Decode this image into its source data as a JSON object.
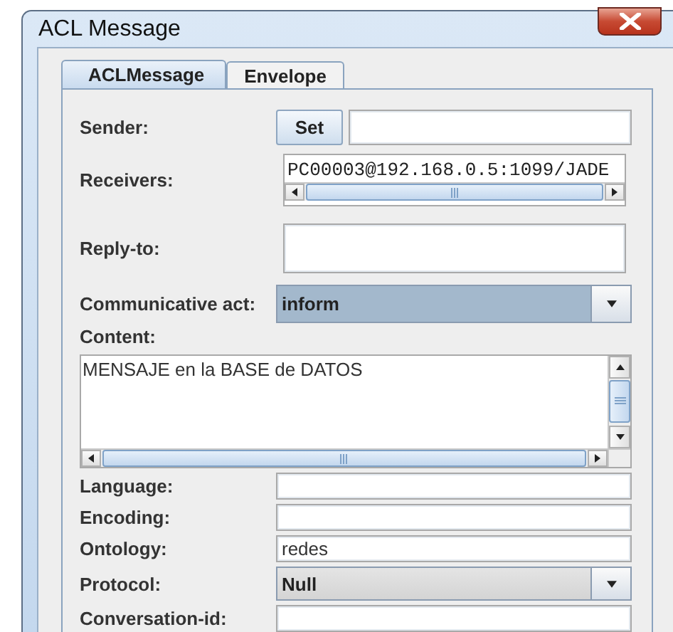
{
  "window": {
    "title": "ACL Message"
  },
  "tabs": [
    {
      "label": "ACLMessage",
      "selected": true
    },
    {
      "label": "Envelope",
      "selected": false
    }
  ],
  "fields": [
    {
      "kind": "button_field",
      "label": "Sender:",
      "button": "Set"
    },
    {
      "kind": "list",
      "label": "Receivers:",
      "items": [
        "PC00003@192.168.0.5:1099/JADE"
      ]
    },
    {
      "kind": "area",
      "label": "Reply-to:"
    },
    {
      "kind": "combo",
      "label": "Communicative act:",
      "value": "inform",
      "focused": true
    },
    {
      "kind": "textarea",
      "label": "Content:",
      "value": "MENSAJE en la BASE de DATOS"
    },
    {
      "kind": "text",
      "label": "Language:"
    },
    {
      "kind": "text",
      "label": "Encoding:"
    },
    {
      "kind": "text",
      "label": "Ontology:",
      "value": "redes"
    },
    {
      "kind": "combo",
      "label": "Protocol:",
      "value": "Null",
      "focused": false
    },
    {
      "kind": "text",
      "label": "Conversation-id:"
    }
  ]
}
